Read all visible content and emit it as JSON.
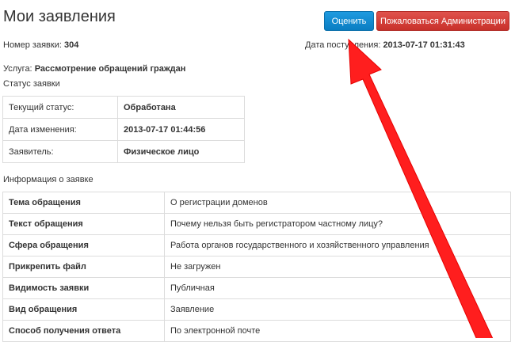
{
  "header": {
    "title": "Мои заявления",
    "rate_button": "Оценить",
    "complain_button": "Пожаловаться Администрации"
  },
  "request": {
    "number_label": "Номер заявки:",
    "number_value": "304",
    "received_label": "Дата поступления:",
    "received_value": "2013-07-17 01:31:43",
    "service_label": "Услуга:",
    "service_value": "Рассмотрение обращений граждан"
  },
  "status_section": {
    "heading": "Статус заявки",
    "rows": [
      {
        "label": "Текущий статус:",
        "value": "Обработана"
      },
      {
        "label": "Дата изменения:",
        "value": "2013-07-17 01:44:56"
      },
      {
        "label": "Заявитель:",
        "value": "Физическое лицо"
      }
    ]
  },
  "info_section": {
    "heading": "Информация о заявке",
    "rows": [
      {
        "label": "Тема обращения",
        "value": "О регистрации доменов"
      },
      {
        "label": "Текст обращения",
        "value": "Почему нельзя быть регистратором частному лицу?"
      },
      {
        "label": "Сфера обращения",
        "value": "Работа органов государственного и хозяйственного управления"
      },
      {
        "label": "Прикрепить файл",
        "value": "Не загружен"
      },
      {
        "label": "Видимость заявки",
        "value": "Публичная"
      },
      {
        "label": "Вид обращения",
        "value": "Заявление"
      },
      {
        "label": "Способ получения ответа",
        "value": "По электронной почте"
      }
    ]
  },
  "colors": {
    "rate_button": "#1a8fd6",
    "complain_button": "#d4403a",
    "annotation_arrow": "#ff1e1e"
  }
}
